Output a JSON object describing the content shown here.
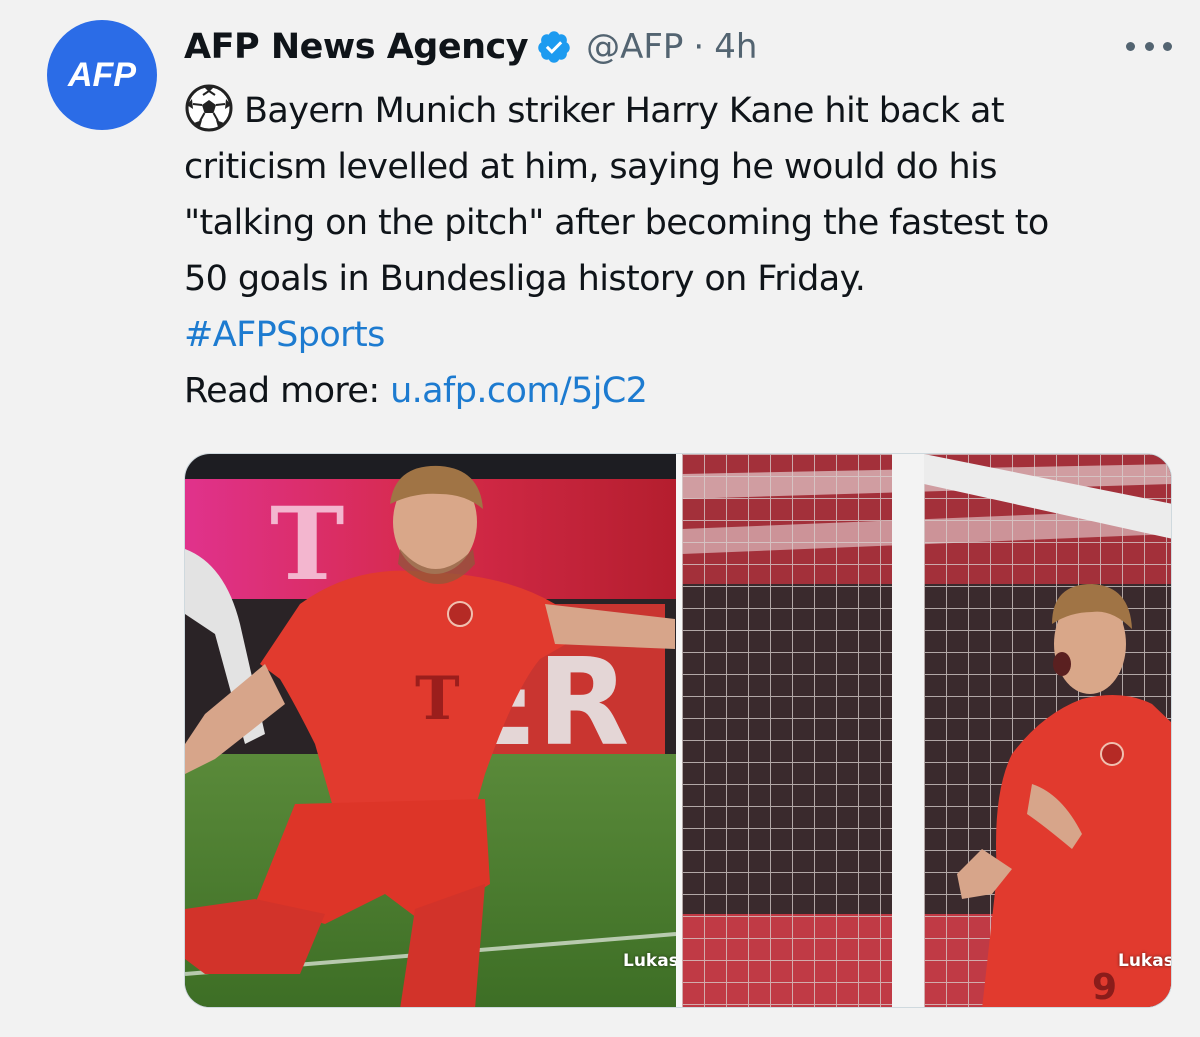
{
  "author": {
    "avatar_text": "AFP",
    "display_name": "AFP News Agency",
    "handle": "@AFP",
    "separator": "·",
    "time": "4h"
  },
  "tweet": {
    "text_line1": "Bayern Munich striker Harry Kane hit back at",
    "text_line2": "criticism levelled at him, saying he would do his",
    "text_line3": "\"talking on the pitch\" after becoming the fastest to",
    "text_line4": "50 goals in Bundesliga history on Friday.",
    "hashtag": "#AFPSports",
    "read_more_label": "Read more:",
    "link": "u.afp.com/5jC2"
  },
  "media": {
    "left_credit": "Lukas",
    "right_credit": "Lukas",
    "jersey_number": "9"
  },
  "icons": {
    "verified": "verified-badge-icon",
    "soccer": "soccer-ball-icon",
    "more": "more-options-icon"
  },
  "colors": {
    "avatar_bg": "#2b6ce7",
    "link": "#1d7bd0",
    "verified": "#1d9bf0",
    "muted": "#536471",
    "jersey_red": "#e13a2e"
  }
}
